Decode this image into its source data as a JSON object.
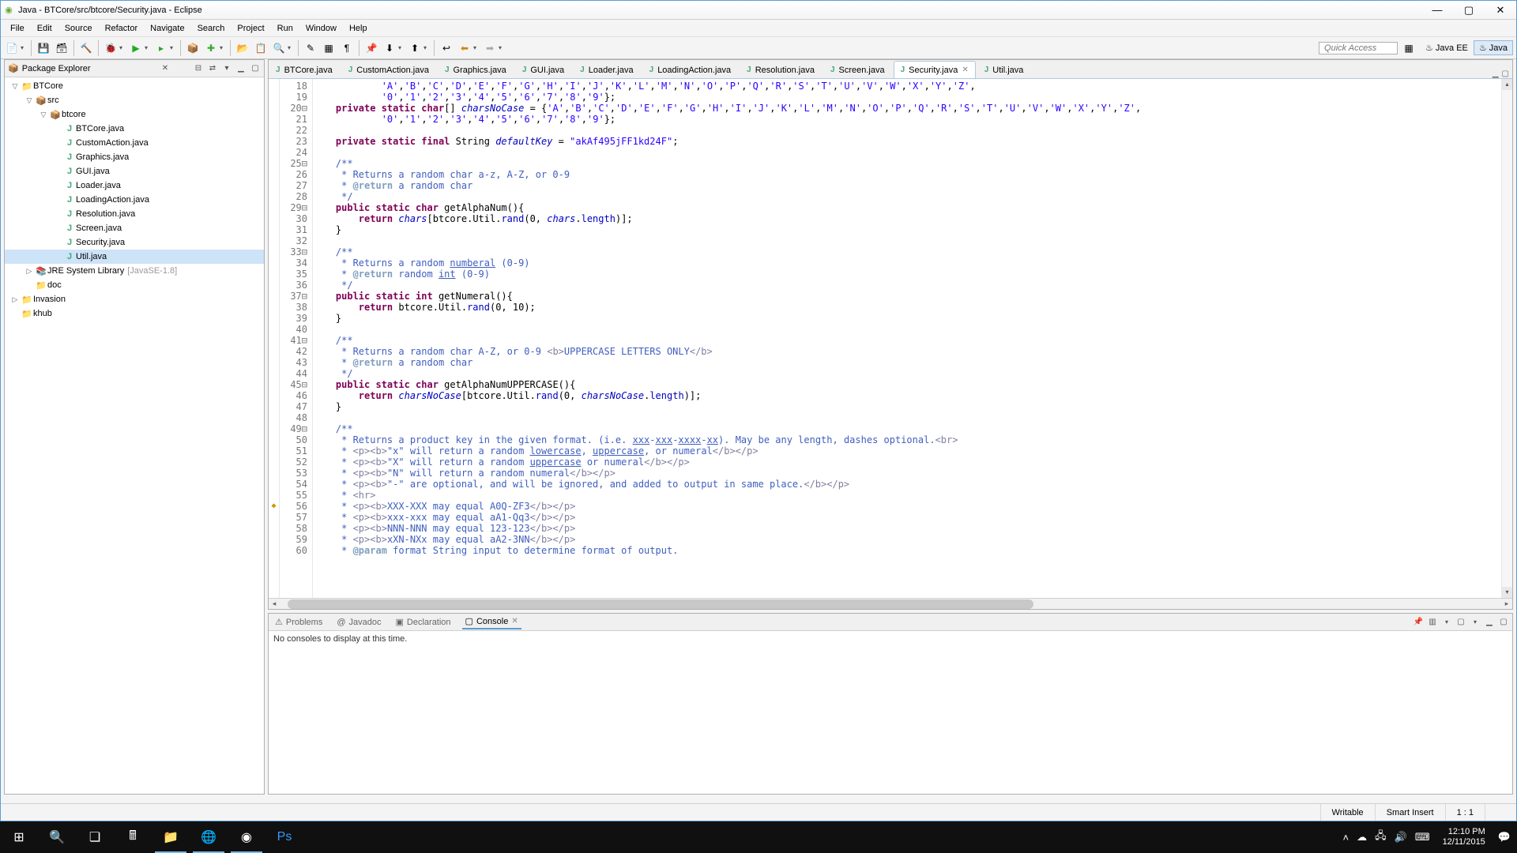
{
  "window": {
    "title": "Java - BTCore/src/btcore/Security.java - Eclipse"
  },
  "menus": [
    "File",
    "Edit",
    "Source",
    "Refactor",
    "Navigate",
    "Search",
    "Project",
    "Run",
    "Window",
    "Help"
  ],
  "quick_access_placeholder": "Quick Access",
  "perspectives": [
    {
      "label": "Java EE",
      "active": false
    },
    {
      "label": "Java",
      "active": true
    }
  ],
  "package_explorer": {
    "title": "Package Explorer",
    "tree": [
      {
        "depth": 0,
        "twisty": "▽",
        "icon": "📁",
        "label": "BTCore",
        "sel": false
      },
      {
        "depth": 1,
        "twisty": "▽",
        "icon": "📦",
        "label": "src",
        "sel": false
      },
      {
        "depth": 2,
        "twisty": "▽",
        "icon": "📦",
        "label": "btcore",
        "sel": false
      },
      {
        "depth": 3,
        "twisty": "",
        "icon": "J",
        "label": "BTCore.java",
        "sel": false
      },
      {
        "depth": 3,
        "twisty": "",
        "icon": "J",
        "label": "CustomAction.java",
        "sel": false
      },
      {
        "depth": 3,
        "twisty": "",
        "icon": "J",
        "label": "Graphics.java",
        "sel": false
      },
      {
        "depth": 3,
        "twisty": "",
        "icon": "J",
        "label": "GUI.java",
        "sel": false
      },
      {
        "depth": 3,
        "twisty": "",
        "icon": "J",
        "label": "Loader.java",
        "sel": false
      },
      {
        "depth": 3,
        "twisty": "",
        "icon": "J",
        "label": "LoadingAction.java",
        "sel": false
      },
      {
        "depth": 3,
        "twisty": "",
        "icon": "J",
        "label": "Resolution.java",
        "sel": false
      },
      {
        "depth": 3,
        "twisty": "",
        "icon": "J",
        "label": "Screen.java",
        "sel": false
      },
      {
        "depth": 3,
        "twisty": "",
        "icon": "J",
        "label": "Security.java",
        "sel": false
      },
      {
        "depth": 3,
        "twisty": "",
        "icon": "J",
        "label": "Util.java",
        "sel": true
      },
      {
        "depth": 1,
        "twisty": "▷",
        "icon": "📚",
        "label": "JRE System Library",
        "sub": "[JavaSE-1.8]",
        "sel": false
      },
      {
        "depth": 1,
        "twisty": "",
        "icon": "📁",
        "label": "doc",
        "sel": false
      },
      {
        "depth": 0,
        "twisty": "▷",
        "icon": "📁",
        "label": "Invasion",
        "sel": false
      },
      {
        "depth": 0,
        "twisty": "",
        "icon": "📁",
        "label": "khub",
        "sel": false
      }
    ]
  },
  "editor_tabs": [
    {
      "label": "BTCore.java",
      "active": false
    },
    {
      "label": "CustomAction.java",
      "active": false
    },
    {
      "label": "Graphics.java",
      "active": false
    },
    {
      "label": "GUI.java",
      "active": false
    },
    {
      "label": "Loader.java",
      "active": false
    },
    {
      "label": "LoadingAction.java",
      "active": false
    },
    {
      "label": "Resolution.java",
      "active": false
    },
    {
      "label": "Screen.java",
      "active": false
    },
    {
      "label": "Security.java",
      "active": true
    },
    {
      "label": "Util.java",
      "active": false
    }
  ],
  "editor": {
    "first_line": 18,
    "last_line": 60,
    "lines": [
      {
        "n": 18,
        "html": "            <span class='str'>'A'</span>,<span class='str'>'B'</span>,<span class='str'>'C'</span>,<span class='str'>'D'</span>,<span class='str'>'E'</span>,<span class='str'>'F'</span>,<span class='str'>'G'</span>,<span class='str'>'H'</span>,<span class='str'>'I'</span>,<span class='str'>'J'</span>,<span class='str'>'K'</span>,<span class='str'>'L'</span>,<span class='str'>'M'</span>,<span class='str'>'N'</span>,<span class='str'>'O'</span>,<span class='str'>'P'</span>,<span class='str'>'Q'</span>,<span class='str'>'R'</span>,<span class='str'>'S'</span>,<span class='str'>'T'</span>,<span class='str'>'U'</span>,<span class='str'>'V'</span>,<span class='str'>'W'</span>,<span class='str'>'X'</span>,<span class='str'>'Y'</span>,<span class='str'>'Z'</span>,"
      },
      {
        "n": 19,
        "html": "            <span class='str'>'0'</span>,<span class='str'>'1'</span>,<span class='str'>'2'</span>,<span class='str'>'3'</span>,<span class='str'>'4'</span>,<span class='str'>'5'</span>,<span class='str'>'6'</span>,<span class='str'>'7'</span>,<span class='str'>'8'</span>,<span class='str'>'9'</span>};"
      },
      {
        "n": 20,
        "fold": true,
        "html": "    <span class='kw'>private static char</span>[] <span class='fld'>charsNoCase</span> = {<span class='str'>'A'</span>,<span class='str'>'B'</span>,<span class='str'>'C'</span>,<span class='str'>'D'</span>,<span class='str'>'E'</span>,<span class='str'>'F'</span>,<span class='str'>'G'</span>,<span class='str'>'H'</span>,<span class='str'>'I'</span>,<span class='str'>'J'</span>,<span class='str'>'K'</span>,<span class='str'>'L'</span>,<span class='str'>'M'</span>,<span class='str'>'N'</span>,<span class='str'>'O'</span>,<span class='str'>'P'</span>,<span class='str'>'Q'</span>,<span class='str'>'R'</span>,<span class='str'>'S'</span>,<span class='str'>'T'</span>,<span class='str'>'U'</span>,<span class='str'>'V'</span>,<span class='str'>'W'</span>,<span class='str'>'X'</span>,<span class='str'>'Y'</span>,<span class='str'>'Z'</span>,"
      },
      {
        "n": 21,
        "html": "            <span class='str'>'0'</span>,<span class='str'>'1'</span>,<span class='str'>'2'</span>,<span class='str'>'3'</span>,<span class='str'>'4'</span>,<span class='str'>'5'</span>,<span class='str'>'6'</span>,<span class='str'>'7'</span>,<span class='str'>'8'</span>,<span class='str'>'9'</span>};"
      },
      {
        "n": 22,
        "html": ""
      },
      {
        "n": 23,
        "html": "    <span class='kw'>private static final</span> String <span class='fld'>defaultKey</span> = <span class='str'>\"akAf495jFF1kd24F\"</span>;"
      },
      {
        "n": 24,
        "html": ""
      },
      {
        "n": 25,
        "fold": true,
        "html": "    <span class='jtxt'>/**</span>"
      },
      {
        "n": 26,
        "html": "<span class='jtxt'>     * Returns a random char a-z, A-Z, or 0-9</span>"
      },
      {
        "n": 27,
        "html": "<span class='jtxt'>     * </span><span class='jtag'>@return</span><span class='jtxt'> a random char</span>"
      },
      {
        "n": 28,
        "html": "<span class='jtxt'>     */</span>"
      },
      {
        "n": 29,
        "fold": true,
        "html": "    <span class='kw'>public static char</span> getAlphaNum(){"
      },
      {
        "n": 30,
        "html": "        <span class='kw'>return</span> <span class='fld'>chars</span>[btcore.Util.<span class='fldn'>rand</span>(0, <span class='fld'>chars</span>.<span class='fldn'>length</span>)];"
      },
      {
        "n": 31,
        "html": "    }"
      },
      {
        "n": 32,
        "html": ""
      },
      {
        "n": 33,
        "fold": true,
        "html": "    <span class='jtxt'>/**</span>"
      },
      {
        "n": 34,
        "html": "<span class='jtxt'>     * Returns a random <u>numberal</u> (0-9)</span>"
      },
      {
        "n": 35,
        "html": "<span class='jtxt'>     * </span><span class='jtag'>@return</span><span class='jtxt'> random <u>int</u> (0-9)</span>"
      },
      {
        "n": 36,
        "html": "<span class='jtxt'>     */</span>"
      },
      {
        "n": 37,
        "fold": true,
        "html": "    <span class='kw'>public static int</span> getNumeral(){"
      },
      {
        "n": 38,
        "html": "        <span class='kw'>return</span> btcore.Util.<span class='fldn'>rand</span>(0, 10);"
      },
      {
        "n": 39,
        "html": "    }"
      },
      {
        "n": 40,
        "html": ""
      },
      {
        "n": 41,
        "fold": true,
        "html": "    <span class='jtxt'>/**</span>"
      },
      {
        "n": 42,
        "html": "<span class='jtxt'>     * Returns a random char A-Z, or 0-9 </span><span class='jhtml'>&lt;b&gt;</span><span class='jtxt'>UPPERCASE LETTERS ONLY</span><span class='jhtml'>&lt;/b&gt;</span>"
      },
      {
        "n": 43,
        "html": "<span class='jtxt'>     * </span><span class='jtag'>@return</span><span class='jtxt'> a random char</span>"
      },
      {
        "n": 44,
        "html": "<span class='jtxt'>     */</span>"
      },
      {
        "n": 45,
        "fold": true,
        "html": "    <span class='kw'>public static char</span> getAlphaNumUPPERCASE(){"
      },
      {
        "n": 46,
        "html": "        <span class='kw'>return</span> <span class='fld'>charsNoCase</span>[btcore.Util.<span class='fldn'>rand</span>(0, <span class='fld'>charsNoCase</span>.<span class='fldn'>length</span>)];"
      },
      {
        "n": 47,
        "html": "    }"
      },
      {
        "n": 48,
        "html": ""
      },
      {
        "n": 49,
        "fold": true,
        "html": "    <span class='jtxt'>/**</span>"
      },
      {
        "n": 50,
        "html": "<span class='jtxt'>     * Returns a product key in the given format. (i.e. <u>xxx</u>-<u>xxx</u>-<u>xxxx</u>-<u>xx</u>). May be any length, dashes optional.</span><span class='jhtml'>&lt;br&gt;</span>"
      },
      {
        "n": 51,
        "html": "<span class='jtxt'>     * </span><span class='jhtml'>&lt;p&gt;&lt;b&gt;</span><span class='jtxt'>\"x\" will return a random <u>lowercase</u>, <u>uppercase</u>, or numeral</span><span class='jhtml'>&lt;/b&gt;&lt;/p&gt;</span>"
      },
      {
        "n": 52,
        "html": "<span class='jtxt'>     * </span><span class='jhtml'>&lt;p&gt;&lt;b&gt;</span><span class='jtxt'>\"X\" will return a random <u>uppercase</u> or numeral</span><span class='jhtml'>&lt;/b&gt;&lt;/p&gt;</span>"
      },
      {
        "n": 53,
        "html": "<span class='jtxt'>     * </span><span class='jhtml'>&lt;p&gt;&lt;b&gt;</span><span class='jtxt'>\"N\" will return a random numeral</span><span class='jhtml'>&lt;/b&gt;&lt;/p&gt;</span>"
      },
      {
        "n": 54,
        "html": "<span class='jtxt'>     * </span><span class='jhtml'>&lt;p&gt;&lt;b&gt;</span><span class='jtxt'>\"-\" are optional, and will be ignored, and added to output in same place.</span><span class='jhtml'>&lt;/b&gt;&lt;/p&gt;</span>"
      },
      {
        "n": 55,
        "html": "<span class='jtxt'>     * </span><span class='jhtml'>&lt;hr&gt;</span>"
      },
      {
        "n": 56,
        "mark": true,
        "html": "<span class='jtxt'>     * </span><span class='jhtml'>&lt;p&gt;&lt;b&gt;</span><span class='jlink'>XXX-XXX</span><span class='jtxt'> may equal A0Q-ZF3</span><span class='jhtml'>&lt;/b&gt;&lt;/p&gt;</span>"
      },
      {
        "n": 57,
        "html": "<span class='jtxt'>     * </span><span class='jhtml'>&lt;p&gt;&lt;b&gt;</span><span class='jlink'>xxx-xxx</span><span class='jtxt'> may equal aA1-Qq3</span><span class='jhtml'>&lt;/b&gt;&lt;/p&gt;</span>"
      },
      {
        "n": 58,
        "html": "<span class='jtxt'>     * </span><span class='jhtml'>&lt;p&gt;&lt;b&gt;</span><span class='jlink'>NNN-NNN</span><span class='jtxt'> may equal 123-123</span><span class='jhtml'>&lt;/b&gt;&lt;/p&gt;</span>"
      },
      {
        "n": 59,
        "html": "<span class='jtxt'>     * </span><span class='jhtml'>&lt;p&gt;&lt;b&gt;</span><span class='jlink'>xXN-NXx</span><span class='jtxt'> may equal aA2-3NN</span><span class='jhtml'>&lt;/b&gt;&lt;/p&gt;</span>"
      },
      {
        "n": 60,
        "html": "<span class='jtxt'>     * </span><span class='jtag'>@param</span><span class='jtxt'> format String input to determine format of output.</span>"
      }
    ]
  },
  "bottom_tabs": [
    {
      "label": "Problems",
      "icon": "⚠",
      "active": false
    },
    {
      "label": "Javadoc",
      "icon": "@",
      "active": false
    },
    {
      "label": "Declaration",
      "icon": "▣",
      "active": false
    },
    {
      "label": "Console",
      "icon": "▢",
      "active": true
    }
  ],
  "console_message": "No consoles to display at this time.",
  "status": {
    "writable": "Writable",
    "insert": "Smart Insert",
    "position": "1 : 1"
  },
  "tray": {
    "time": "12:10 PM",
    "date": "12/11/2015"
  }
}
